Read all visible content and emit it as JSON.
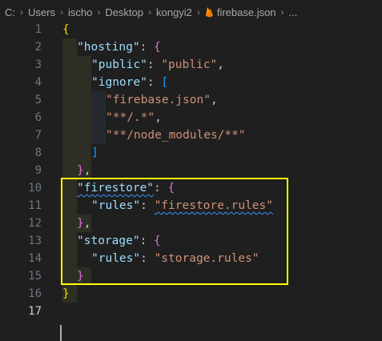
{
  "breadcrumb": {
    "segments": [
      "C:",
      "Users",
      "ischo",
      "Desktop",
      "kongyi2"
    ],
    "file": "firebase.json",
    "trailing": "..."
  },
  "editor": {
    "line_numbers": [
      "1",
      "2",
      "3",
      "4",
      "5",
      "6",
      "7",
      "8",
      "9",
      "10",
      "11",
      "12",
      "13",
      "14",
      "15",
      "16",
      "17"
    ],
    "active_line": "17",
    "lines": [
      [
        {
          "t": "{",
          "c": "bracket-y"
        }
      ],
      [
        {
          "t": "\"hosting\"",
          "c": "key"
        },
        {
          "t": ": ",
          "c": "punct"
        },
        {
          "t": "{",
          "c": "bracket-p"
        }
      ],
      [
        {
          "t": "\"public\"",
          "c": "key"
        },
        {
          "t": ": ",
          "c": "punct"
        },
        {
          "t": "\"public\"",
          "c": "str"
        },
        {
          "t": ",",
          "c": "punct"
        }
      ],
      [
        {
          "t": "\"ignore\"",
          "c": "key"
        },
        {
          "t": ": ",
          "c": "punct"
        },
        {
          "t": "[",
          "c": "bracket-b"
        }
      ],
      [
        {
          "t": "\"firebase.json\"",
          "c": "str"
        },
        {
          "t": ",",
          "c": "punct"
        }
      ],
      [
        {
          "t": "\"**/.*\"",
          "c": "str"
        },
        {
          "t": ",",
          "c": "punct"
        }
      ],
      [
        {
          "t": "\"**/node_modules/**\"",
          "c": "str"
        }
      ],
      [
        {
          "t": "]",
          "c": "bracket-b"
        }
      ],
      [
        {
          "t": "}",
          "c": "bracket-p"
        },
        {
          "t": ",",
          "c": "punct"
        }
      ],
      [
        {
          "t": "\"firestore\"",
          "c": "key squiggle"
        },
        {
          "t": ": ",
          "c": "punct"
        },
        {
          "t": "{",
          "c": "bracket-p"
        }
      ],
      [
        {
          "t": "\"rules\"",
          "c": "key"
        },
        {
          "t": ": ",
          "c": "punct"
        },
        {
          "t": "\"firestore.rules\"",
          "c": "str squiggle"
        }
      ],
      [
        {
          "t": "}",
          "c": "bracket-p"
        },
        {
          "t": ",",
          "c": "punct"
        }
      ],
      [
        {
          "t": "\"storage\"",
          "c": "key"
        },
        {
          "t": ": ",
          "c": "punct"
        },
        {
          "t": "{",
          "c": "bracket-p"
        }
      ],
      [
        {
          "t": "\"rules\"",
          "c": "key"
        },
        {
          "t": ": ",
          "c": "punct"
        },
        {
          "t": "\"storage.rules\"",
          "c": "str"
        }
      ],
      [
        {
          "t": "}",
          "c": "bracket-p"
        }
      ],
      [
        {
          "t": "}",
          "c": "bracket-y"
        }
      ],
      []
    ]
  },
  "colors": {
    "background": "#1f1f1f",
    "highlight_box": "#ffff00",
    "key": "#9cdcfe",
    "string": "#ce9178"
  }
}
